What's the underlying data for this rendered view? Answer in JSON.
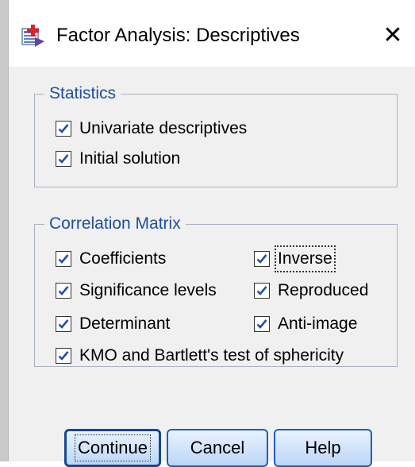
{
  "window": {
    "title": "Factor Analysis: Descriptives",
    "close_glyph": "✕"
  },
  "statistics": {
    "legend": "Statistics",
    "items": [
      {
        "label": "Univariate descriptives",
        "checked": true
      },
      {
        "label": "Initial solution",
        "checked": true
      }
    ]
  },
  "correlation": {
    "legend": "Correlation Matrix",
    "items": [
      {
        "label": "Coefficients",
        "checked": true
      },
      {
        "label": "Inverse",
        "checked": true
      },
      {
        "label": "Significance levels",
        "checked": true
      },
      {
        "label": "Reproduced",
        "checked": true
      },
      {
        "label": "Determinant",
        "checked": true
      },
      {
        "label": "Anti-image",
        "checked": true
      },
      {
        "label": "KMO and Bartlett's test of sphericity",
        "checked": true
      }
    ]
  },
  "buttons": {
    "continue": "Continue",
    "cancel": "Cancel",
    "help": "Help"
  },
  "icons": {
    "app": "factor-analysis-app-icon",
    "check": "checkmark-icon"
  },
  "colors": {
    "legend_text": "#1f4f9c",
    "button_border": "#1f5fb8"
  }
}
